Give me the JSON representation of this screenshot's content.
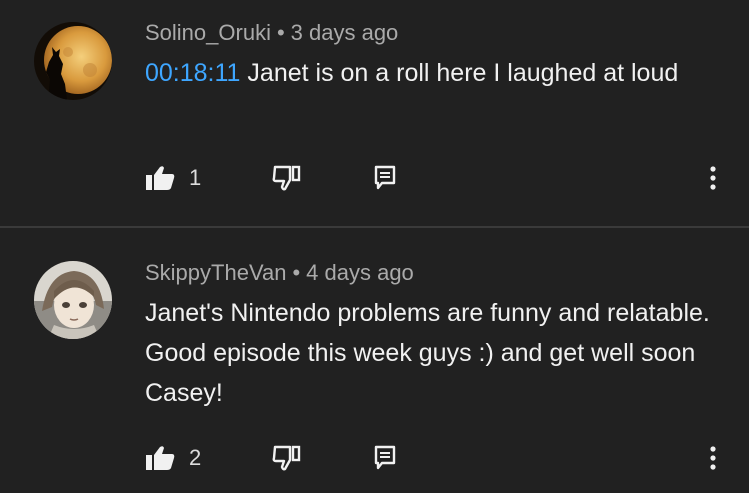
{
  "comments": [
    {
      "author": "Solino_Oruki",
      "separator": "•",
      "age": "3 days ago",
      "timestamp": "00:18:11",
      "text": " Janet is on a roll here I laughed at loud",
      "likes": "1",
      "avatar_icon": "wolf-moon-avatar"
    },
    {
      "author": "SkippyTheVan",
      "separator": "•",
      "age": "4 days ago",
      "timestamp": "",
      "text": "Janet's Nintendo problems are funny and relatable. Good episode this week guys :) and get well soon Casey!",
      "likes": "2",
      "avatar_icon": "anime-character-avatar"
    }
  ],
  "icons": {
    "like": "thumbs-up-icon",
    "dislike": "thumbs-down-icon",
    "reply": "reply-icon",
    "more": "more-vert-icon"
  },
  "colors": {
    "background": "#212121",
    "timestamp_link": "#3ea6ff",
    "meta_text": "#aaaaaa",
    "body_text": "#f1f1f1"
  }
}
